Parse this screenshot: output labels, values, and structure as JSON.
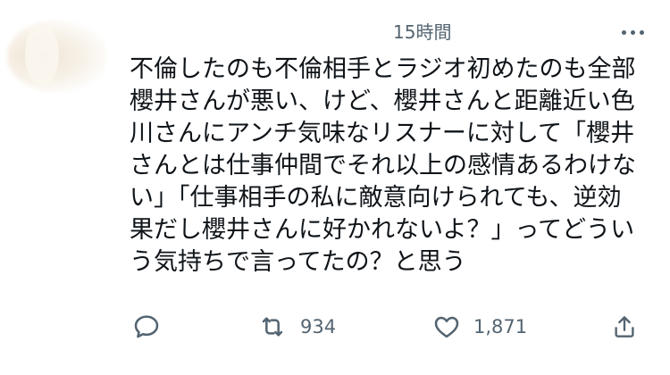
{
  "tweet": {
    "time": "15時間",
    "lines": [
      "不倫したのも不倫相手とラジオ初めたのも全部",
      "櫻井さんが悪い、けど、櫻井さんと距離近い色",
      "川さんにアンチ気味なリスナーに対して「櫻井",
      "さんとは仕事仲間でそれ以上の感情あるわけな",
      "い」「仕事相手の私に敵意向けられても、逆効",
      "果だし櫻井さんに好かれないよ？」ってどうい",
      "う気持ちで言ってたの？と思う"
    ],
    "actions": {
      "reply_icon": "reply-icon",
      "retweet_icon": "retweet-icon",
      "retweet_count": "934",
      "like_icon": "heart-icon",
      "like_count": "1,871",
      "share_icon": "share-icon"
    }
  },
  "colors": {
    "text": "#0f1419",
    "muted": "#536471",
    "background": "#ffffff"
  }
}
